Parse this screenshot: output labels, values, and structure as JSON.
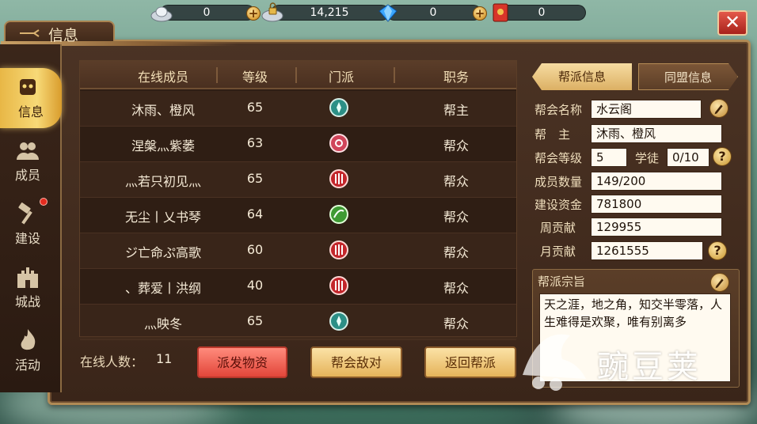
{
  "resources": [
    {
      "icon": "silver-ingot-icon",
      "value": "0",
      "has_plus": true
    },
    {
      "icon": "locked-silver-icon",
      "value": "14,215",
      "has_plus": false
    },
    {
      "icon": "diamond-icon",
      "value": "0",
      "has_plus": true
    },
    {
      "icon": "red-envelope-icon",
      "value": "0",
      "has_plus": false
    }
  ],
  "panel": {
    "title": "信息",
    "close_label": "✕"
  },
  "sidebar": {
    "items": [
      {
        "label": "信息",
        "icon": "info-icon",
        "active": true
      },
      {
        "label": "成员",
        "icon": "members-icon",
        "active": false
      },
      {
        "label": "建设",
        "icon": "hammer-icon",
        "active": false,
        "badge": true
      },
      {
        "label": "城战",
        "icon": "castle-icon",
        "active": false
      },
      {
        "label": "活动",
        "icon": "flame-icon",
        "active": false
      }
    ]
  },
  "table": {
    "headers": [
      "在线成员",
      "等级",
      "门派",
      "职务"
    ],
    "rows": [
      {
        "name": "沐雨、橙风",
        "level": "65",
        "sect": "teal",
        "role": "帮主"
      },
      {
        "name": "涅槃灬紫萎",
        "level": "63",
        "sect": "pink",
        "role": "帮众"
      },
      {
        "name": "灬若只初见灬",
        "level": "65",
        "sect": "red",
        "role": "帮众"
      },
      {
        "name": "无尘丨乂书琴",
        "level": "64",
        "sect": "green",
        "role": "帮众"
      },
      {
        "name": "ジ亡命ぷ高歌",
        "level": "60",
        "sect": "red",
        "role": "帮众"
      },
      {
        "name": "、葬爱丨洪纲",
        "level": "40",
        "sect": "red",
        "role": "帮众"
      },
      {
        "name": "灬映冬",
        "level": "65",
        "sect": "teal",
        "role": "帮众"
      }
    ]
  },
  "footer": {
    "online_label": "在线人数：",
    "online_count": "11",
    "buttons": [
      "派发物资",
      "帮会敌对",
      "返回帮派"
    ]
  },
  "info_tabs": [
    "帮派信息",
    "同盟信息"
  ],
  "guild": {
    "name_label": "帮会名称",
    "name": "水云阁",
    "leader_label": "帮　主",
    "leader": "沐雨、橙风",
    "level_label": "帮会等级",
    "level": "5",
    "apprentice_label": "学徒",
    "apprentice": "0/10",
    "members_label": "成员数量",
    "members": "149/200",
    "funds_label": "建设资金",
    "funds": "781800",
    "weekly_label": "周贡献",
    "weekly": "129955",
    "monthly_label": "月贡献",
    "monthly": "1261555",
    "motto_label": "帮派宗旨",
    "motto": "天之涯，地之角，知交半零落，人生难得是欢聚，唯有别离多"
  },
  "watermark": {
    "text": "豌豆荚"
  },
  "colors": {
    "panel_bg": "#3a2519",
    "frame_gold": "#b08a55",
    "active_tab": "#f7d977",
    "red_button": "#e2463a",
    "gold_button": "#e5b35a",
    "sect_teal": "#2c8f86",
    "sect_pink": "#d0455a",
    "sect_red": "#c2262b",
    "sect_green": "#3f9a33"
  }
}
